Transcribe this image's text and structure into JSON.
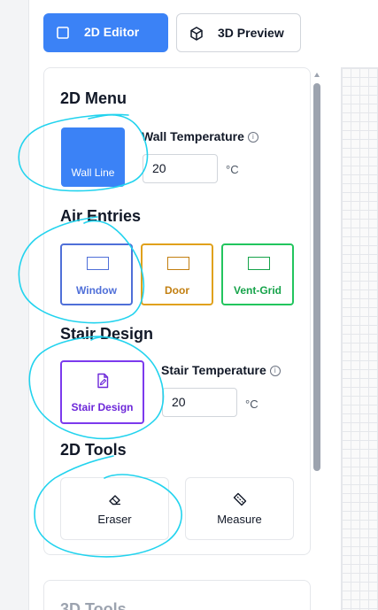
{
  "mode_tabs": {
    "editor_2d": {
      "label": "2D Editor",
      "icon": "square-icon",
      "active": true,
      "color": "#3b82f6"
    },
    "preview_3d": {
      "label": "3D Preview",
      "icon": "cube-icon"
    }
  },
  "panel": {
    "title": "2D Menu",
    "wall_line_label": "Wall Line",
    "wall_temperature": {
      "label": "Wall Temperature",
      "value": "20",
      "unit": "°C"
    },
    "air_entries": {
      "title": "Air Entries",
      "items": [
        {
          "label": "Window",
          "color": "#4f6fd8"
        },
        {
          "label": "Door",
          "color": "#e0a11b"
        },
        {
          "label": "Vent-Grid",
          "color": "#22c55e"
        }
      ]
    },
    "stair_design": {
      "title": "Stair Design",
      "button_label": "Stair Design",
      "temperature": {
        "label": "Stair Temperature",
        "value": "20",
        "unit": "°C"
      }
    },
    "tools_2d": {
      "title": "2D Tools",
      "eraser_label": "Eraser",
      "measure_label": "Measure"
    }
  },
  "next_panel": {
    "title": "3D Tools"
  },
  "annotation_color": "#22d3ee"
}
